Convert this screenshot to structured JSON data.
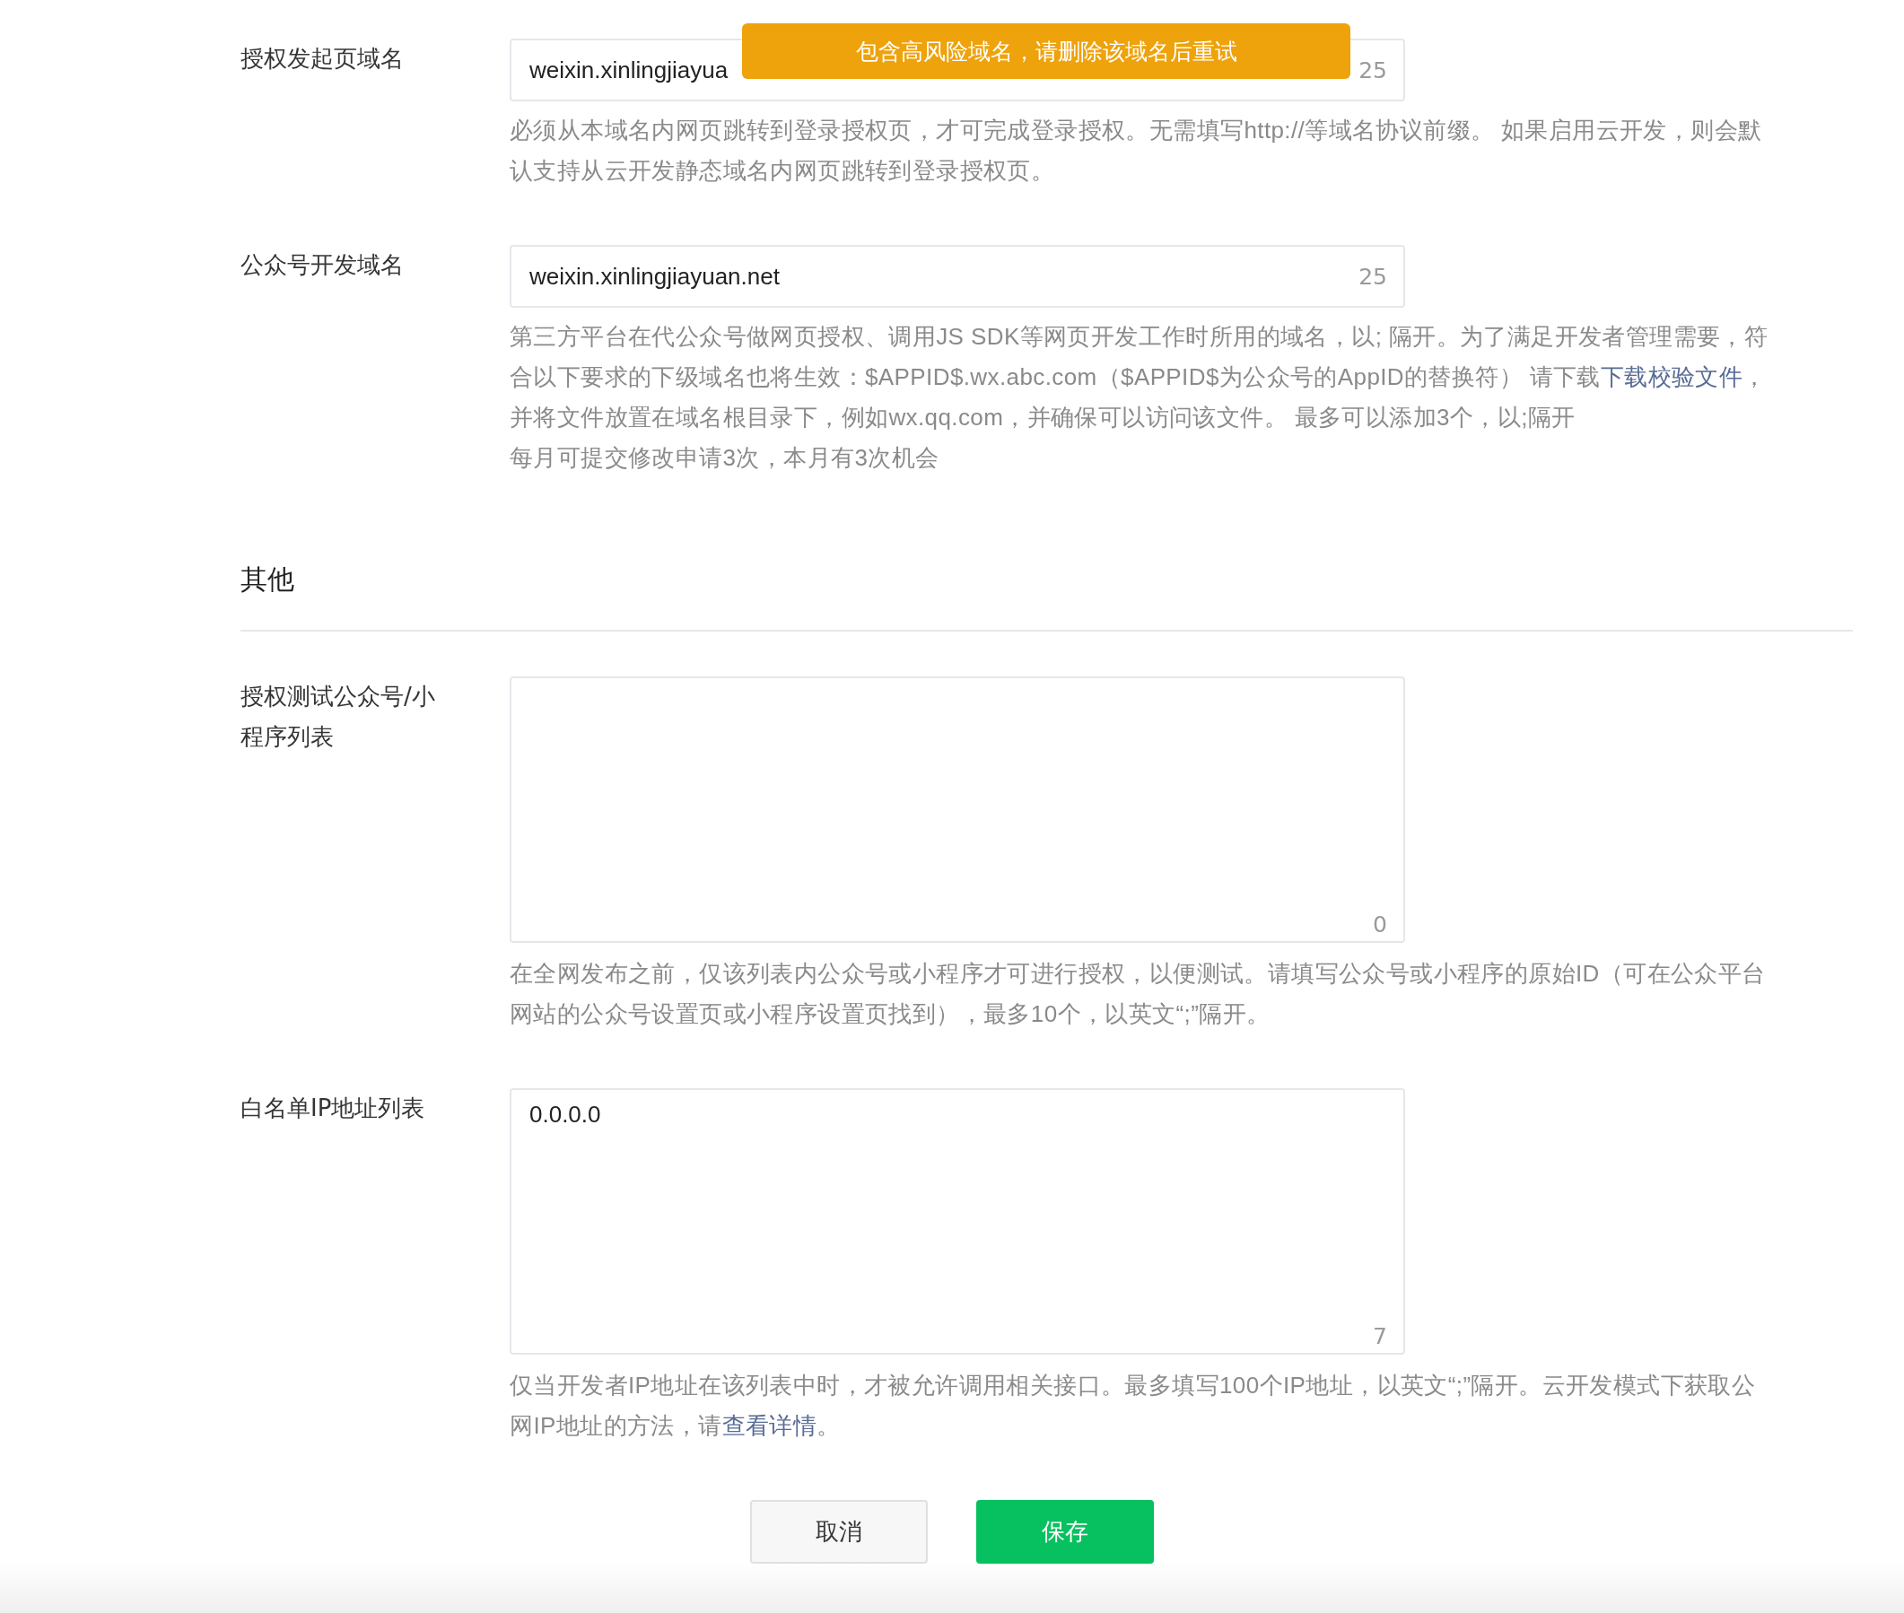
{
  "toast": {
    "kind": "warning",
    "message": "包含高风险域名，请删除该域名后重试"
  },
  "sections": [
    {
      "fields": [
        {
          "kind": "input",
          "label": "授权发起页域名",
          "value": "weixin.xinlingjiayua",
          "count": "25",
          "help": [
            [
              {
                "text": "必须从本域名内网页跳转到登录授权页，才可完成登录授权。无需填写http://等域名协议前缀。 如果启用云开发，则会默"
              }
            ],
            [
              {
                "text": "认支持从云开发静态域名内网页跳转到登录授权页。"
              }
            ]
          ]
        },
        {
          "kind": "input",
          "label": "公众号开发域名",
          "value": "weixin.xinlingjiayuan.net",
          "count": "25",
          "help": [
            [
              {
                "text": "第三方平台在代公众号做网页授权、调用JS SDK等网页开发工作时所用的域名，以; 隔开。为了满足开发者管理需要，符"
              }
            ],
            [
              {
                "text": "合以下要求的下级域名也将生效：$APPID$.wx.abc.com（$APPID$为公众号的AppID的替换符） 请下载"
              },
              {
                "text": "下载校验文件",
                "link": true
              },
              {
                "text": "，"
              }
            ],
            [
              {
                "text": "并将文件放置在域名根目录下，例如wx.qq.com，并确保可以访问该文件。 最多可以添加3个，以;隔开"
              }
            ],
            [
              {
                "text": "每月可提交修改申请3次，本月有3次机会"
              }
            ]
          ]
        }
      ]
    },
    {
      "title": "其他",
      "fields": [
        {
          "kind": "textarea",
          "label": "授权测试公众号/小程序列表",
          "count": "0",
          "help": [
            [
              {
                "text": "在全网发布之前，仅该列表内公众号或小程序才可进行授权，以便测试。请填写公众号或小程序的原始ID（可在公众平台"
              }
            ],
            [
              {
                "text": "网站的公众号设置页或小程序设置页找到），最多10个，以英文“;”隔开。"
              }
            ]
          ]
        },
        {
          "kind": "textarea",
          "label": "白名单IP地址列表",
          "value": "0.0.0.0",
          "count": "7",
          "help": [
            [
              {
                "text": "仅当开发者IP地址在该列表中时，才被允许调用相关接口。最多填写100个IP地址，以英文“;”隔开。云开发模式下获取公"
              }
            ],
            [
              {
                "text": "网IP地址的方法，请"
              },
              {
                "text": "查看详情",
                "link": true
              },
              {
                "text": "。"
              }
            ]
          ]
        }
      ]
    }
  ],
  "buttons": [
    {
      "kind": "default",
      "label": "取消"
    },
    {
      "kind": "primary",
      "label": "保存"
    }
  ]
}
